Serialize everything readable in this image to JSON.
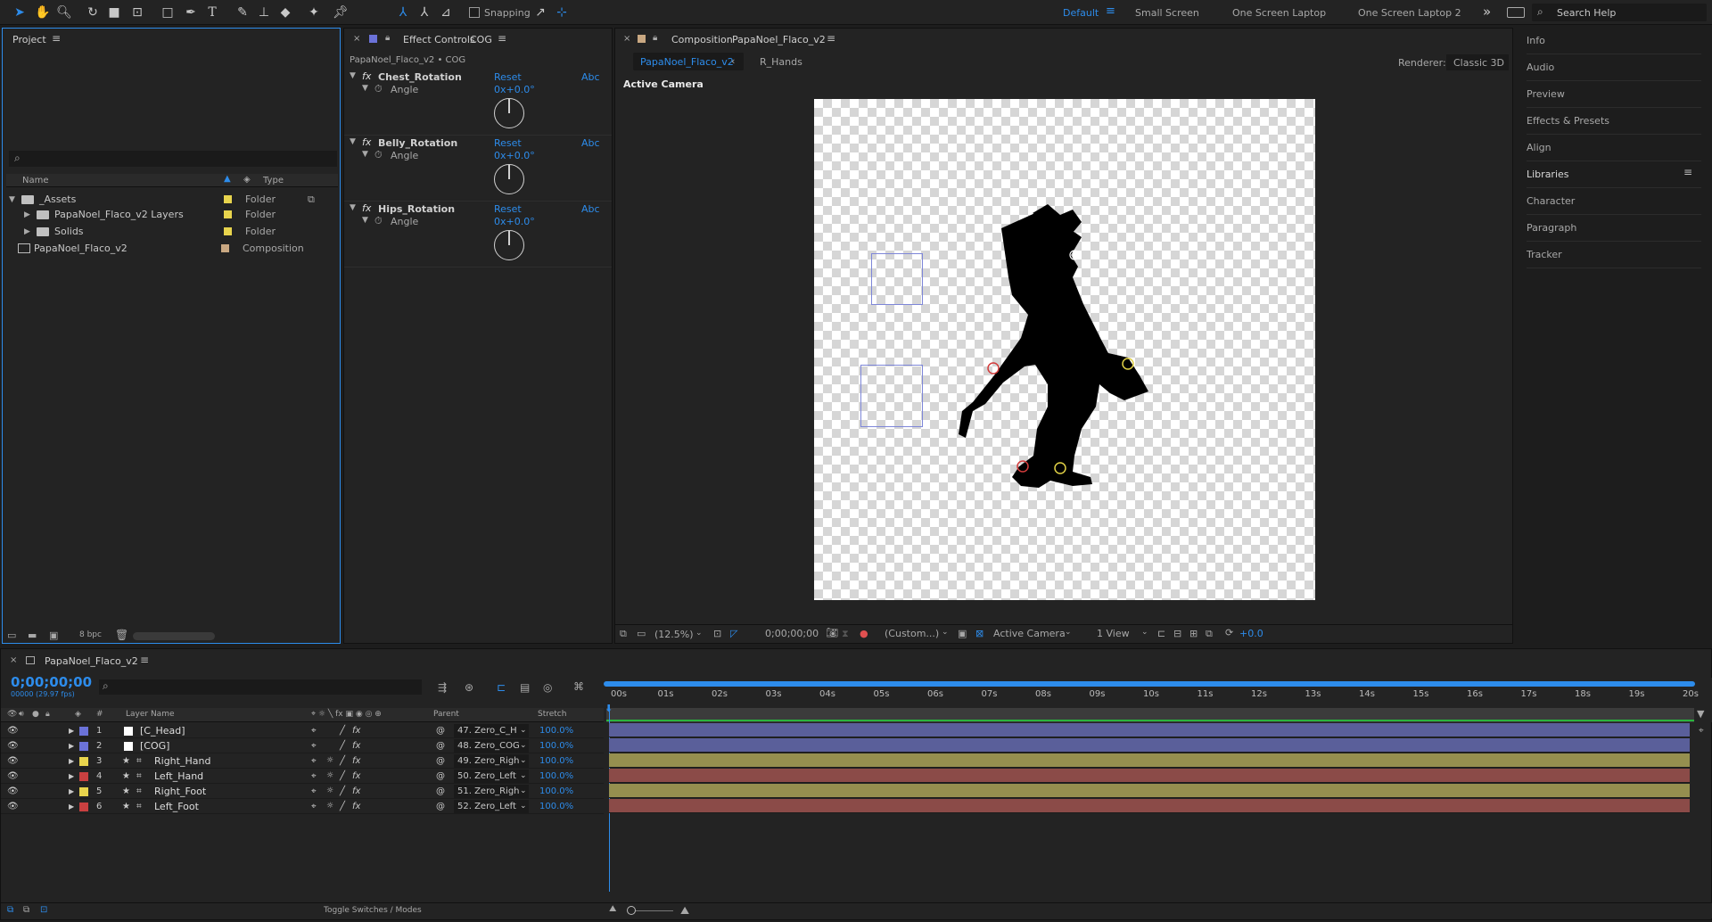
{
  "toolbar": {
    "snapping_label": "Snapping",
    "workspaces": [
      "Default",
      "Small Screen",
      "One Screen Laptop",
      "One Screen Laptop 2"
    ],
    "search_placeholder": "Search Help",
    "more": "»"
  },
  "project": {
    "tab": "Project",
    "bpc": "8 bpc",
    "columns": {
      "name": "Name",
      "type": "Type"
    },
    "items": [
      {
        "name": "_Assets",
        "type": "Folder",
        "color": "#e8d44d"
      },
      {
        "name": "PapaNoel_Flaco_v2 Layers",
        "type": "Folder",
        "color": "#e8d44d"
      },
      {
        "name": "Solids",
        "type": "Folder",
        "color": "#e8d44d"
      },
      {
        "name": "PapaNoel_Flaco_v2",
        "type": "Composition",
        "color": "#c9a882"
      }
    ]
  },
  "effects": {
    "tab_prefix": "Effect Controls",
    "tab_layer": "COG",
    "subtitle": "PapaNoel_Flaco_v2 • COG",
    "reset": "Reset",
    "abc": "Abc",
    "items": [
      {
        "name": "Chest_Rotation",
        "prop": "Angle",
        "value": "0x+0.0°"
      },
      {
        "name": "Belly_Rotation",
        "prop": "Angle",
        "value": "0x+0.0°"
      },
      {
        "name": "Hips_Rotation",
        "prop": "Angle",
        "value": "0x+0.0°"
      }
    ]
  },
  "composition": {
    "tab_prefix": "Composition",
    "tab_name": "PapaNoel_Flaco_v2",
    "viewer_tabs": [
      "PapaNoel_Flaco_v2",
      "R_Hands"
    ],
    "renderer_label": "Renderer:",
    "renderer": "Classic 3D",
    "active_camera": "Active Camera",
    "bottom": {
      "zoom": "(12.5%)",
      "timecode": "0;00;00;00",
      "resolution": "(Custom...)",
      "camera": "Active Camera",
      "views": "1 View",
      "exposure": "+0.0"
    }
  },
  "right_panels": [
    "Info",
    "Audio",
    "Preview",
    "Effects & Presets",
    "Align",
    "Libraries",
    "Character",
    "Paragraph",
    "Tracker"
  ],
  "timeline": {
    "tab": "PapaNoel_Flaco_v2",
    "timecode": "0;00;00;00",
    "frames": "00000 (29.97 fps)",
    "columns": {
      "num": "#",
      "layer_name": "Layer Name",
      "parent": "Parent",
      "stretch": "Stretch"
    },
    "ruler": [
      "00s",
      "01s",
      "02s",
      "03s",
      "04s",
      "05s",
      "06s",
      "07s",
      "08s",
      "09s",
      "10s",
      "11s",
      "12s",
      "13s",
      "14s",
      "15s",
      "16s",
      "17s",
      "18s",
      "19s",
      "20s"
    ],
    "toggle_label": "Toggle Switches / Modes",
    "layers": [
      {
        "num": "1",
        "name": "[C_Head]",
        "label_color": "#6b72d8",
        "parent": "47. Zero_C_H",
        "stretch": "100.0%",
        "bar_color": "#5a5f9a",
        "star": false
      },
      {
        "num": "2",
        "name": "[COG]",
        "label_color": "#6b72d8",
        "parent": "48. Zero_COG",
        "stretch": "100.0%",
        "bar_color": "#5a5f9a",
        "star": false
      },
      {
        "num": "3",
        "name": "Right_Hand",
        "label_color": "#e8d44d",
        "parent": "49. Zero_Righ",
        "stretch": "100.0%",
        "bar_color": "#958f4f",
        "star": true
      },
      {
        "num": "4",
        "name": "Left_Hand",
        "label_color": "#c94040",
        "parent": "50. Zero_Left",
        "stretch": "100.0%",
        "bar_color": "#8b4b48",
        "star": true
      },
      {
        "num": "5",
        "name": "Right_Foot",
        "label_color": "#e8d44d",
        "parent": "51. Zero_Righ",
        "stretch": "100.0%",
        "bar_color": "#958f4f",
        "star": true
      },
      {
        "num": "6",
        "name": "Left_Foot",
        "label_color": "#c94040",
        "parent": "52. Zero_Left",
        "stretch": "100.0%",
        "bar_color": "#8b4b48",
        "star": true
      }
    ]
  }
}
